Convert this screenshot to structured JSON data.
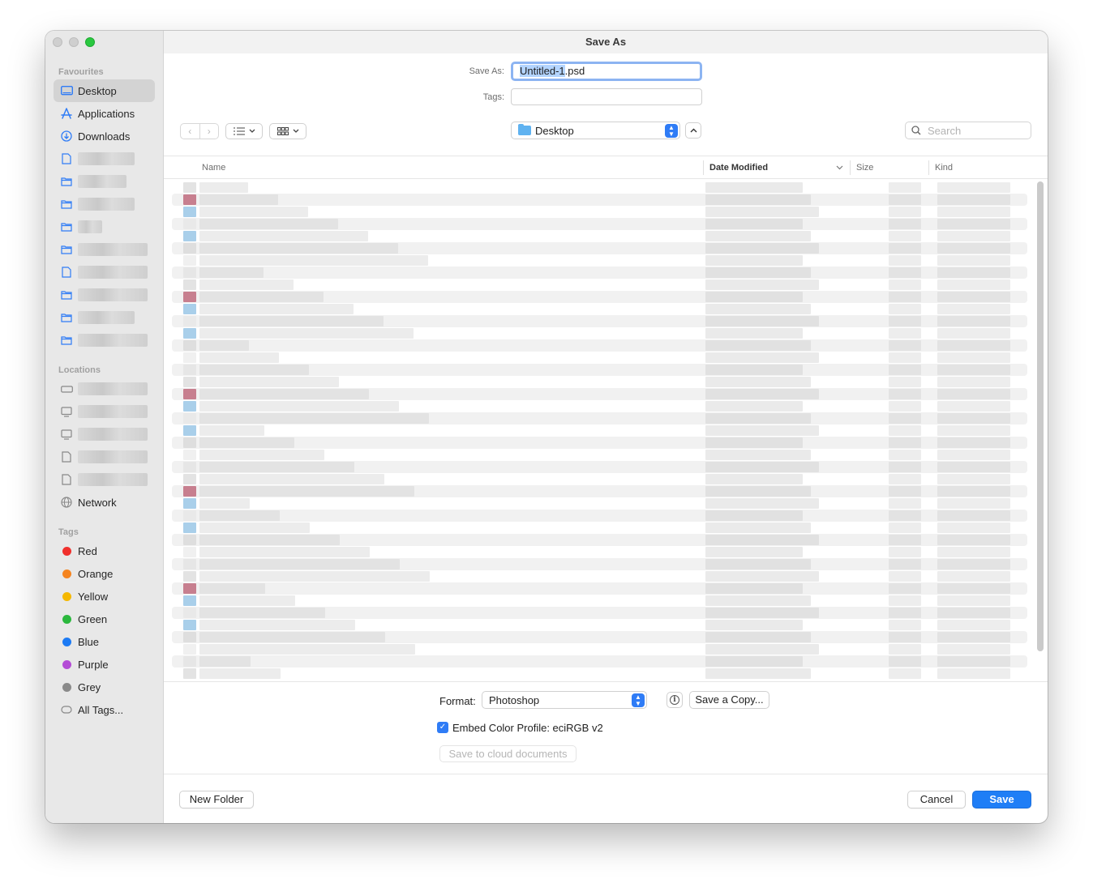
{
  "window": {
    "title": "Save As"
  },
  "sidebar": {
    "favourites_header": "Favourites",
    "favourites": [
      {
        "label": "Desktop",
        "icon": "desktop-icon",
        "active": true
      },
      {
        "label": "Applications",
        "icon": "applications-icon"
      },
      {
        "label": "Downloads",
        "icon": "downloads-icon"
      }
    ],
    "locations_header": "Locations",
    "network_label": "Network",
    "tags_header": "Tags",
    "tags": [
      {
        "label": "Red",
        "color": "#f0302c"
      },
      {
        "label": "Orange",
        "color": "#f5841f"
      },
      {
        "label": "Yellow",
        "color": "#f5b800"
      },
      {
        "label": "Green",
        "color": "#2bb83d"
      },
      {
        "label": "Blue",
        "color": "#1d7bf4"
      },
      {
        "label": "Purple",
        "color": "#b44cd6"
      },
      {
        "label": "Grey",
        "color": "#8a8a8a"
      }
    ],
    "all_tags_label": "All Tags..."
  },
  "form": {
    "save_as_label": "Save As:",
    "filename_selected": "Untitled-1",
    "filename_ext": ".psd",
    "tags_label": "Tags:"
  },
  "toolbar": {
    "location": "Desktop",
    "search_placeholder": "Search"
  },
  "table": {
    "columns": {
      "name": "Name",
      "date": "Date Modified",
      "size": "Size",
      "kind": "Kind"
    }
  },
  "options": {
    "format_label": "Format:",
    "format_value": "Photoshop",
    "save_copy_label": "Save a Copy...",
    "embed_label": "Embed Color Profile:  eciRGB v2",
    "embed_checked": true,
    "cloud_label": "Save to cloud documents"
  },
  "footer": {
    "new_folder_label": "New Folder",
    "cancel_label": "Cancel",
    "save_label": "Save"
  },
  "colors": {
    "accent": "#1f7ef6",
    "zoom_button": "#2ac840"
  }
}
